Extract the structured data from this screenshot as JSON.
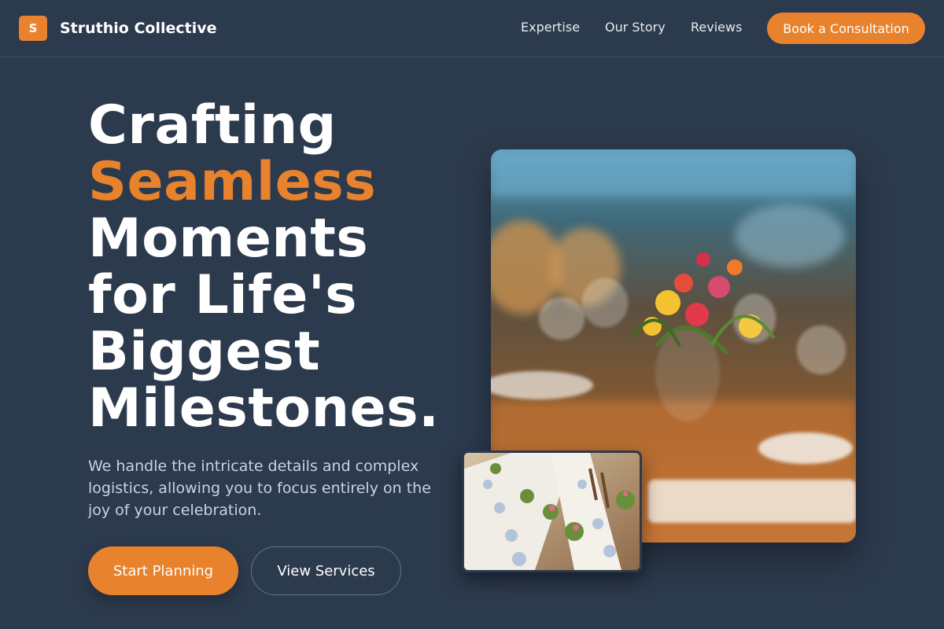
{
  "brand": {
    "logo_letter": "S",
    "name": "Struthio Collective"
  },
  "nav": {
    "items": [
      "Expertise",
      "Our Story",
      "Reviews"
    ],
    "cta": "Book a Consultation"
  },
  "hero": {
    "headline_lines": [
      "Crafting",
      "Seamless",
      "Moments",
      "for Life's",
      "Biggest",
      "Milestones."
    ],
    "subtext": "We handle the intricate details and complex logistics, allowing you to focus entirely on the joy of your celebration.",
    "primary_button": "Start Planning",
    "secondary_button": "View Services"
  },
  "images": {
    "main": "table-setting-photo",
    "secondary": "banquet-tables-photo"
  },
  "colors": {
    "background": "#2c3a4d",
    "accent": "#e8822d",
    "text": "#ffffff",
    "muted_text": "#c9d3e0"
  }
}
